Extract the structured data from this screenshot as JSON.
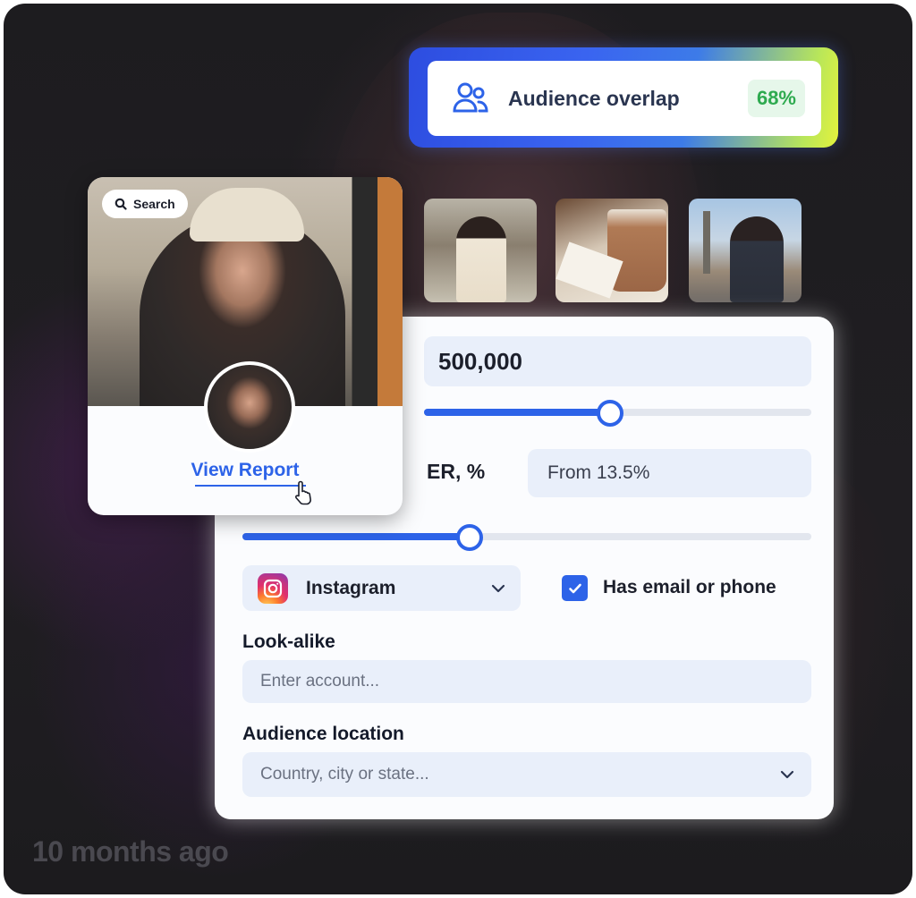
{
  "overlap": {
    "label": "Audience overlap",
    "value": "68%"
  },
  "profile": {
    "search_label": "Search",
    "view_report": "View Report"
  },
  "filters": {
    "followers_value": "500,000",
    "followers_slider_fraction": 0.48,
    "er_label": "ER, %",
    "er_value": "From 13.5%",
    "er_slider_fraction": 0.4,
    "platform_label": "Instagram",
    "has_contact_label": "Has email or phone",
    "has_contact_checked": true,
    "lookalike_label": "Look-alike",
    "lookalike_placeholder": "Enter account...",
    "location_label": "Audience location",
    "location_placeholder": "Country, city or state..."
  },
  "footer": {
    "timestamp": "10 months ago"
  },
  "colors": {
    "accent": "#2d63e8",
    "badge_green": "#2eaa4f"
  },
  "icons": [
    "users-icon",
    "search-icon",
    "instagram-icon",
    "chevron-down-icon",
    "check-icon",
    "pointer-cursor-icon"
  ]
}
